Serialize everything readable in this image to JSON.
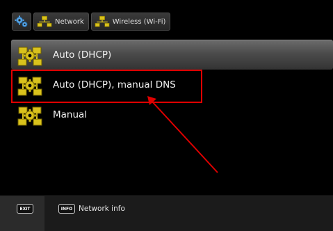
{
  "breadcrumb": {
    "settings_icon": "gears-icon",
    "items": [
      {
        "label": "Network",
        "icon": "network-icon"
      },
      {
        "label": "Wireless (Wi-Fi)",
        "icon": "network-icon"
      }
    ]
  },
  "menu": {
    "items": [
      {
        "label": "Auto (DHCP)",
        "icon": "network-config-icon",
        "selected": true
      },
      {
        "label": "Auto (DHCP), manual DNS",
        "icon": "network-config-icon",
        "highlighted": true
      },
      {
        "label": "Manual",
        "icon": "network-config-icon"
      }
    ]
  },
  "footer": {
    "exit_key": "EXIT",
    "info_key": "INFO",
    "info_label": "Network info"
  },
  "colors": {
    "icon_yellow": "#d9c21c",
    "annotation_red": "#e00000",
    "background": "#000000"
  }
}
